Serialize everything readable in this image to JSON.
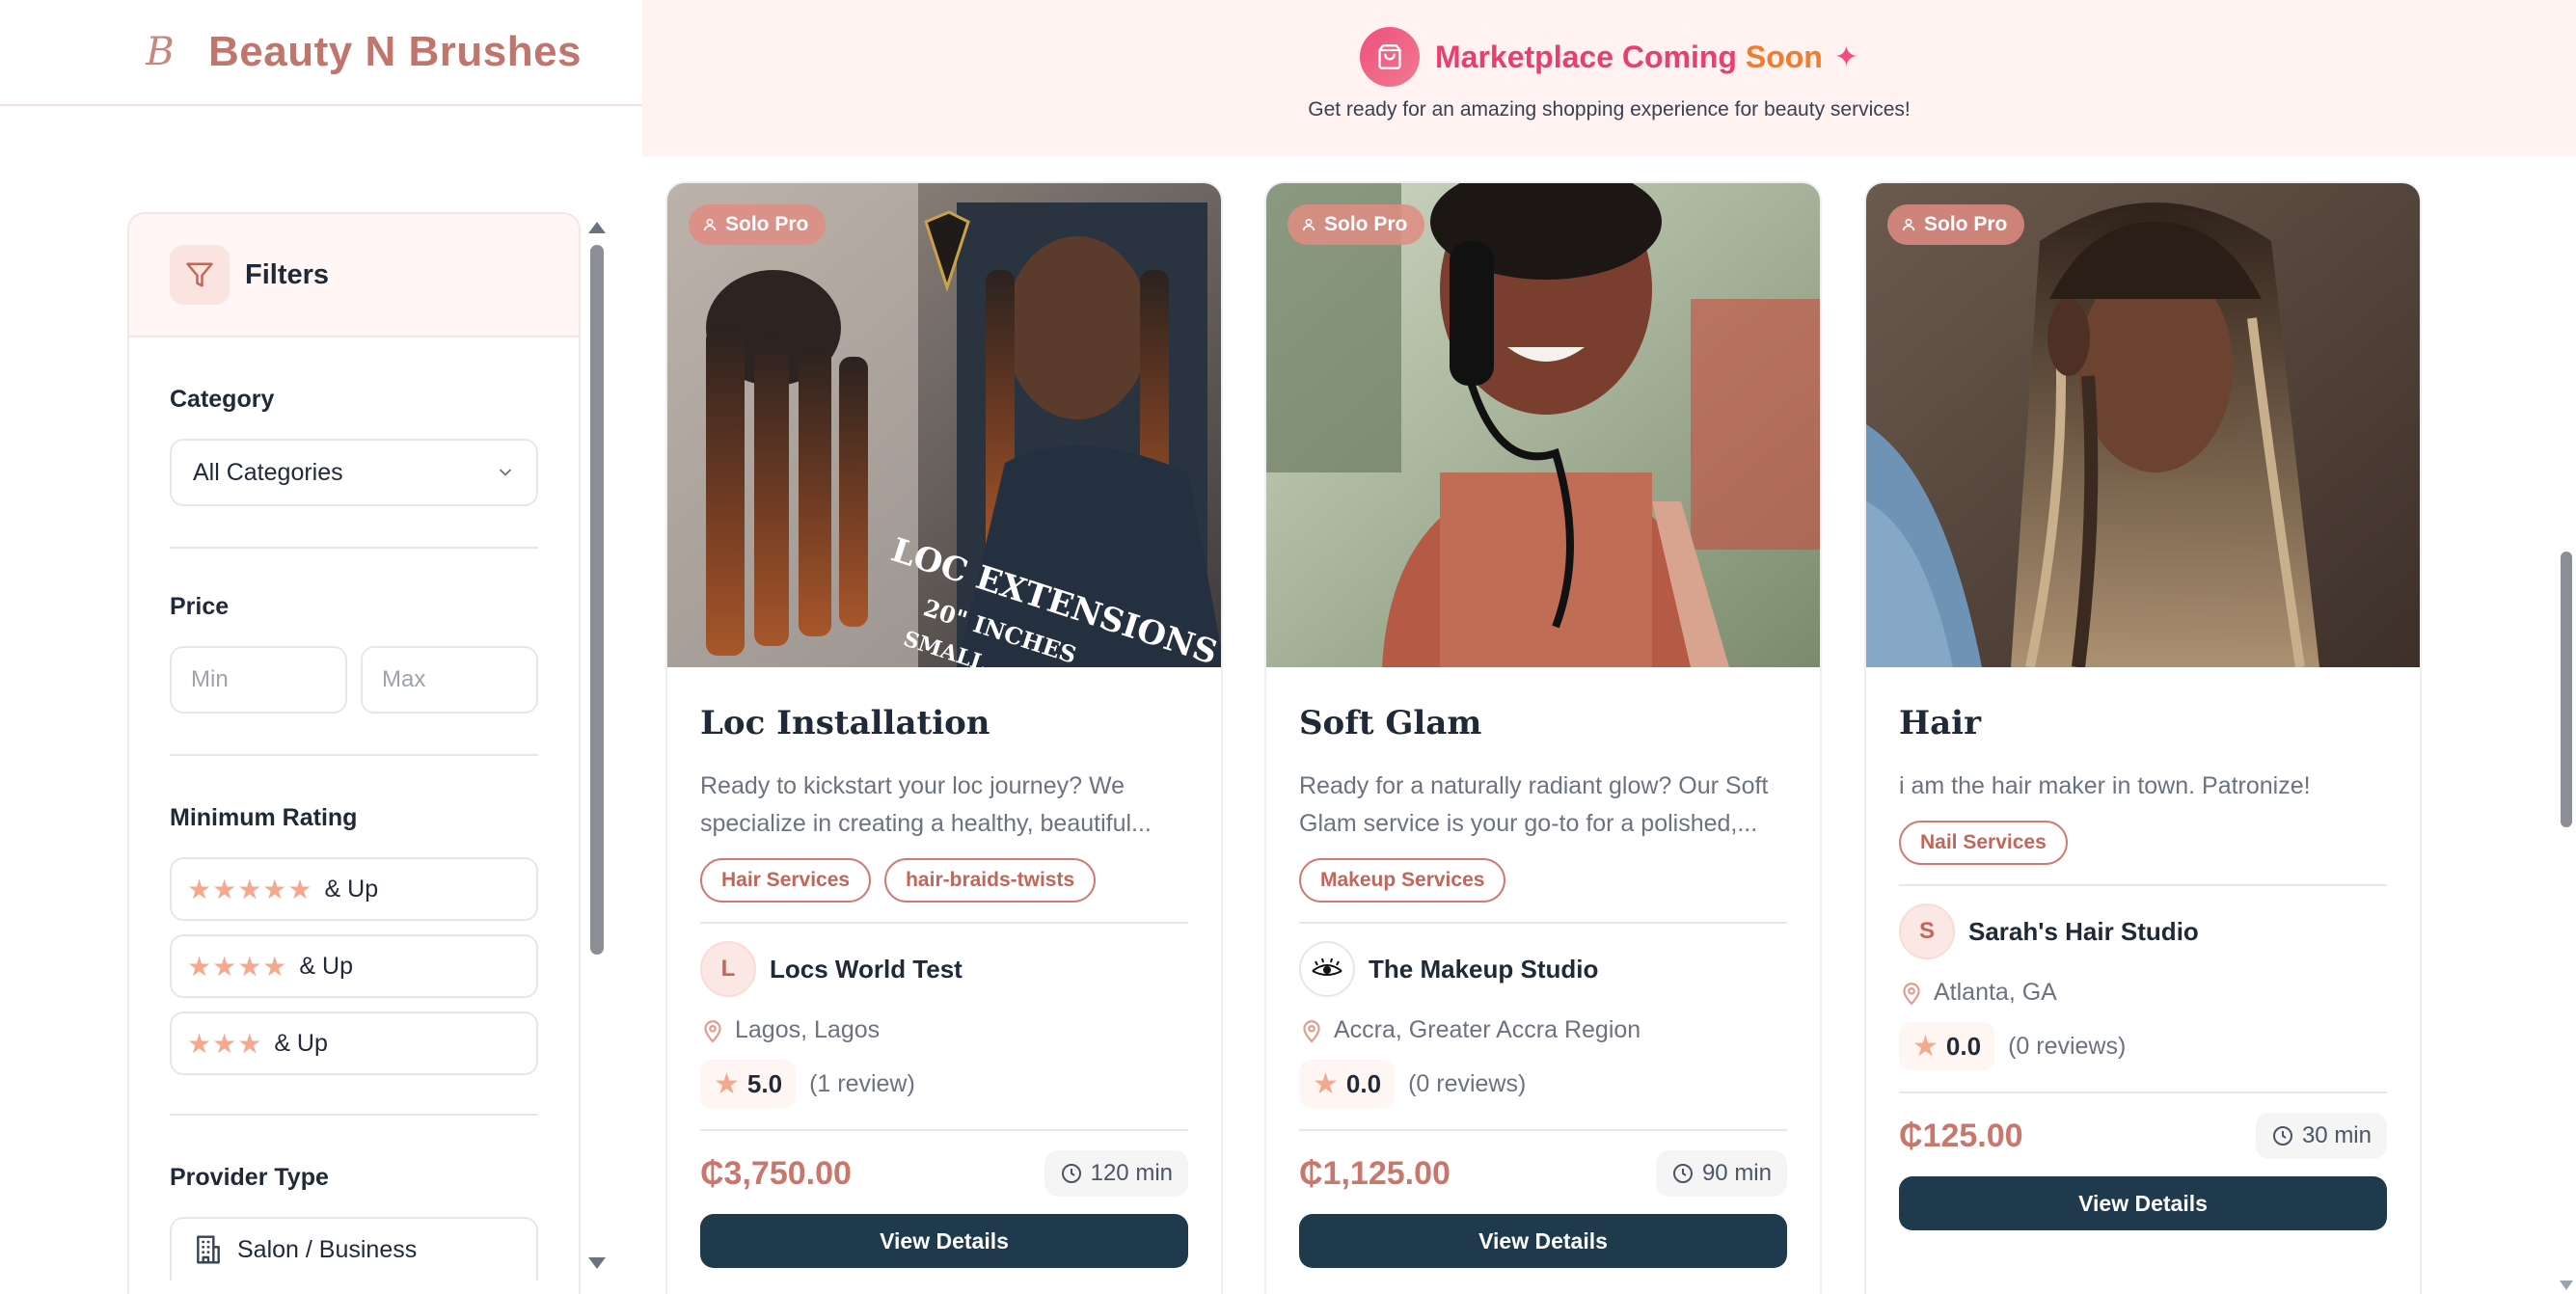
{
  "brand": {
    "logo_text": "B",
    "name": "Beauty N Brushes"
  },
  "banner": {
    "title_main": "Marketplace Coming ",
    "title_accent": "Soon",
    "subtitle": "Get ready for an amazing shopping experience for beauty services!",
    "colors": {
      "pink": "#e83f71",
      "orange": "#f07c2d"
    }
  },
  "filters": {
    "title": "Filters",
    "category": {
      "label": "Category",
      "selected": "All Categories"
    },
    "price": {
      "label": "Price",
      "min_placeholder": "Min",
      "max_placeholder": "Max"
    },
    "rating": {
      "label": "Minimum Rating",
      "options": [
        {
          "stars": "★★★★★",
          "suffix": "& Up",
          "value": 5
        },
        {
          "stars": "★★★★",
          "suffix": "& Up",
          "value": 4
        },
        {
          "stars": "★★★",
          "suffix": "& Up",
          "value": 3
        }
      ]
    },
    "provider": {
      "label": "Provider Type",
      "option": "Salon / Business"
    }
  },
  "cards": [
    {
      "badge": "Solo Pro",
      "title": "Loc Installation",
      "desc_line1": "Ready to kickstart your loc journey? We",
      "desc_line2": "specialize in creating a healthy, beautiful...",
      "tags": [
        "Hair Services",
        "hair-braids-twists"
      ],
      "provider_initial": "L",
      "provider": "Locs World Test",
      "location": "Lagos, Lagos",
      "rating": "5.0",
      "reviews": "(1 review)",
      "price": "₵3,750.00",
      "duration": "120 min",
      "button": "View Details",
      "image_text_1": "LOC EXTENSIONS",
      "image_text_2": "20\" INCHES",
      "image_text_3": "SMALL"
    },
    {
      "badge": "Solo Pro",
      "title": "Soft Glam",
      "desc_line1": "Ready for a naturally radiant glow? Our Soft",
      "desc_line2": "Glam service is your go-to for a polished,...",
      "tags": [
        "Makeup Services"
      ],
      "provider_initial": "",
      "provider": "The Makeup Studio",
      "location": "Accra, Greater Accra Region",
      "rating": "0.0",
      "reviews": "(0 reviews)",
      "price": "₵1,125.00",
      "duration": "90 min",
      "button": "View Details"
    },
    {
      "badge": "Solo Pro",
      "title": "Hair",
      "desc_line1": "i am the hair maker in town. Patronize!",
      "tags": [
        "Nail Services"
      ],
      "provider_initial": "S",
      "provider": "Sarah's Hair Studio",
      "location": "Atlanta, GA",
      "rating": "0.0",
      "reviews": "(0 reviews)",
      "price": "₵125.00",
      "duration": "30 min",
      "button": "View Details"
    }
  ]
}
